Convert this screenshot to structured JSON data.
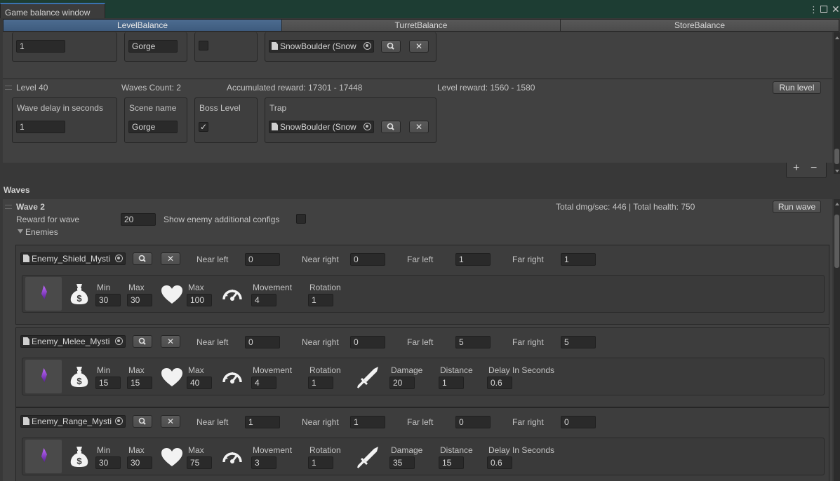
{
  "window": {
    "title": "Game balance window"
  },
  "tabs": [
    {
      "label": "LevelBalance"
    },
    {
      "label": "TurretBalance"
    },
    {
      "label": "StoreBalance"
    }
  ],
  "prev_level": {
    "wave_delay": "1",
    "scene_name": "Gorge",
    "trap": "SnowBoulder (Snow"
  },
  "level": {
    "title": "Level 40",
    "waves_count": "Waves Count: 2",
    "accumulated": "Accumulated reward: 17301 - 17448",
    "reward": "Level reward: 1560 - 1580",
    "run_label": "Run level",
    "wave_delay_label": "Wave delay in seconds",
    "wave_delay": "1",
    "scene_label": "Scene name",
    "scene_name": "Gorge",
    "boss_label": "Boss Level",
    "trap_label": "Trap",
    "trap": "SnowBoulder (Snow"
  },
  "list_controls": {
    "add": "+",
    "remove": "−"
  },
  "waves": {
    "header": "Waves",
    "wave_title": "Wave 2",
    "totals": "Total dmg/sec: 446 | Total health: 750",
    "run_label": "Run wave",
    "reward_label": "Reward for wave",
    "reward": "20",
    "show_configs_label": "Show enemy additional configs",
    "enemies_label": "Enemies"
  },
  "labels": {
    "near_left": "Near left",
    "near_right": "Near right",
    "far_left": "Far left",
    "far_right": "Far right",
    "min": "Min",
    "max": "Max",
    "movement": "Movement",
    "rotation": "Rotation",
    "damage": "Damage",
    "distance": "Distance",
    "delay": "Delay In Seconds"
  },
  "enemies": [
    {
      "name": "Enemy_Shield_Mysti",
      "near_left": "0",
      "near_right": "0",
      "far_left": "1",
      "far_right": "1",
      "reward_min": "30",
      "reward_max": "30",
      "health_max": "100",
      "movement": "4",
      "rotation": "1"
    },
    {
      "name": "Enemy_Melee_Mysti",
      "near_left": "0",
      "near_right": "0",
      "far_left": "5",
      "far_right": "5",
      "reward_min": "15",
      "reward_max": "15",
      "health_max": "40",
      "movement": "4",
      "rotation": "1",
      "damage": "20",
      "distance": "1",
      "delay": "0.6"
    },
    {
      "name": "Enemy_Range_Mysti",
      "near_left": "1",
      "near_right": "1",
      "far_left": "0",
      "far_right": "0",
      "reward_min": "30",
      "reward_max": "30",
      "health_max": "75",
      "movement": "3",
      "rotation": "1",
      "damage": "35",
      "distance": "15",
      "delay": "0.6"
    }
  ],
  "colors": {
    "accent": "#3e5b7e",
    "background": "#383838",
    "field": "#2a2a2a"
  }
}
